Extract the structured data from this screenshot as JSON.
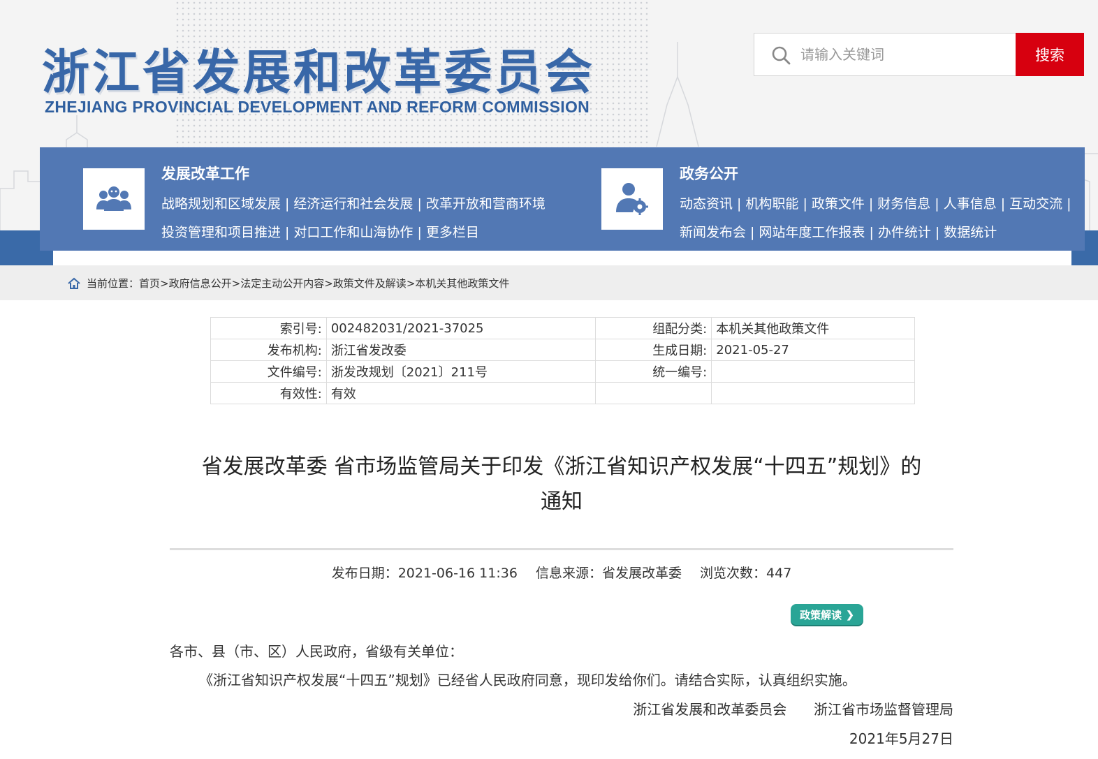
{
  "header": {
    "title_cn": "浙江省发展和改革委员会",
    "title_en": "ZHEJIANG PROVINCIAL DEVELOPMENT AND REFORM COMMISSION",
    "search": {
      "placeholder": "请输入关键词",
      "button_label": "搜索",
      "icon": "search-icon"
    }
  },
  "nav": {
    "sections": [
      {
        "title": "发展改革工作",
        "icon": "team-icon",
        "rows": [
          [
            "战略规划和区域发展",
            "经济运行和社会发展",
            "改革开放和营商环境"
          ],
          [
            "投资管理和项目推进",
            "对口工作和山海协作",
            "更多栏目"
          ]
        ]
      },
      {
        "title": "政务公开",
        "icon": "user-gear-icon",
        "rows": [
          [
            "动态资讯",
            "机构职能",
            "政策文件",
            "财务信息",
            "人事信息",
            "互动交流"
          ],
          [
            "新闻发布会",
            "网站年度工作报表",
            "办件统计",
            "数据统计"
          ]
        ]
      }
    ],
    "separator": "|"
  },
  "breadcrumb": {
    "icon": "home-icon",
    "prefix": "当前位置：",
    "items": [
      "首页",
      "政府信息公开",
      "法定主动公开内容",
      "政策文件及解读",
      "本机关其他政策文件"
    ],
    "separator": ">"
  },
  "meta": {
    "rows": [
      {
        "l1": "索引号:",
        "v1": "002482031/2021-37025",
        "l2": "组配分类:",
        "v2": "本机关其他政策文件"
      },
      {
        "l1": "发布机构:",
        "v1": "浙江省发改委",
        "l2": "生成日期:",
        "v2": "2021-05-27"
      },
      {
        "l1": "文件编号:",
        "v1": "浙发改规划〔2021〕211号",
        "l2": "统一编号:",
        "v2": ""
      },
      {
        "l1": "有效性:",
        "v1": "有效",
        "l2": "",
        "v2": ""
      }
    ]
  },
  "article": {
    "title_line1": "省发展改革委 省市场监管局关于印发《浙江省知识产权发展“十四五”规划》的",
    "title_line2": "通知",
    "publish_label": "发布日期：",
    "publish_date": "2021-06-16 11:36",
    "source_label": "信息来源：",
    "source": "省发展改革委",
    "views_label": "浏览次数：",
    "views": "447",
    "policy_button": "政策解读",
    "salutation": "各市、县（市、区）人民政府，省级有关单位：",
    "body": "《浙江省知识产权发展“十四五”规划》已经省人民政府同意，现印发给你们。请结合实际，认真组织实施。",
    "signature_1": "浙江省发展和改革委员会",
    "signature_2": "浙江省市场监督管理局",
    "sign_date": "2021年5月27日"
  },
  "colors": {
    "brand_blue": "#3867a8",
    "nav_blue": "#5278b4",
    "search_red": "#d7000f",
    "policy_green": "#2aa596"
  }
}
